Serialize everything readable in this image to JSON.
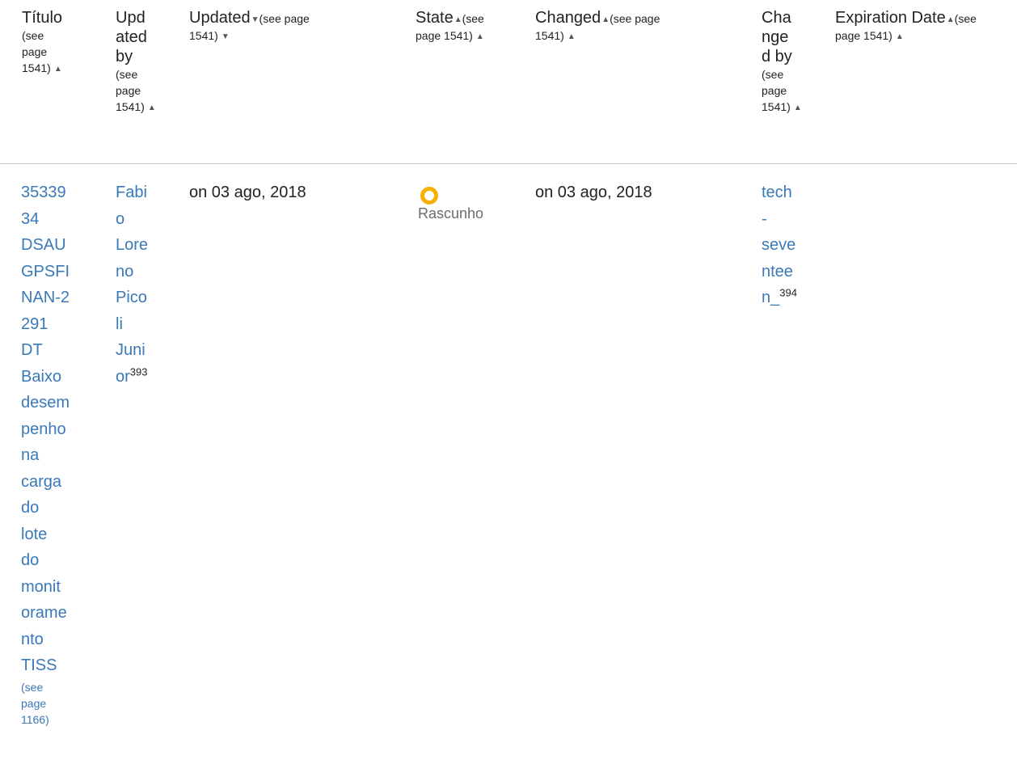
{
  "table": {
    "headers": {
      "titulo": {
        "label": "Título",
        "see_lines": [
          "(see",
          "page",
          "1541)"
        ],
        "arrow": "▲"
      },
      "updated_by": {
        "label_lines": [
          "Upd",
          "ated",
          "by"
        ],
        "see_lines": [
          "(see",
          "page",
          "1541)"
        ],
        "arrow": "▲"
      },
      "updated": {
        "label": "Updated",
        "see_line1": "(see page",
        "see_line2": "1541)",
        "arrow": "▼"
      },
      "state": {
        "label": "State",
        "see_line1": "(see",
        "see_line2": "page 1541)",
        "arrow": "▲"
      },
      "changed": {
        "label": "Changed",
        "see_line1": "(see page",
        "see_line2": "1541)",
        "arrow": "▲"
      },
      "changed_by": {
        "label_lines": [
          "Cha",
          "nge",
          "d by"
        ],
        "see_lines": [
          "(see",
          "page",
          "1541)"
        ],
        "arrow": "▲"
      },
      "expiration": {
        "label": "Expiration Date",
        "see_line1": "(see",
        "see_line2": "page 1541)",
        "arrow": "▲"
      }
    },
    "row": {
      "title_lines": [
        "35339",
        "34",
        "DSAU",
        "GPSFI",
        "NAN-2",
        "291",
        "DT",
        "Baixo",
        "desem",
        "penho",
        "na",
        "carga",
        "do",
        "lote",
        "do",
        "monit",
        "orame",
        "nto",
        "TISS"
      ],
      "title_see_lines": [
        "(see",
        "page",
        "1166)"
      ],
      "updated_by_lines": [
        "Fabi",
        "o",
        "Lore",
        "no",
        "Pico",
        "li",
        "Juni",
        "or"
      ],
      "updated_by_sup": "393",
      "updated": "on 03 ago, 2018",
      "state": "Rascunho",
      "state_color": "#f5b000",
      "changed": "on 03 ago, 2018",
      "changed_by_lines": [
        "tech",
        "-",
        "seve",
        "ntee",
        "n_"
      ],
      "changed_by_sup": "394"
    }
  },
  "colors": {
    "link": "#3a79b8",
    "divider": "#c8c8c8",
    "status_dot": "#f5b000"
  }
}
